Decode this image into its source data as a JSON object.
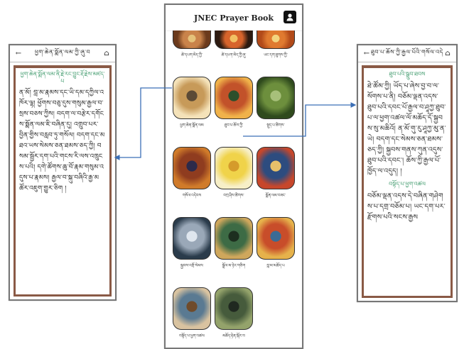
{
  "center": {
    "title": "JNEC Prayer Book",
    "tiles": [
      {
        "caption": "ཚེ་དཔག་མེད་ཀྱི་",
        "colors": [
          "#c9834a",
          "#6b3a1c",
          "#e5c27a"
        ]
      },
      {
        "caption": "ཚེ་དཔག་མེད་ཀྱི་ཞུ་",
        "colors": [
          "#d7642b",
          "#2c1a10",
          "#f2c063"
        ]
      },
      {
        "caption": "ཡང་དག་ཐུགས་ཀྱི་",
        "colors": [
          "#e07a2f",
          "#b24a19",
          "#f3d47e"
        ]
      },
      {
        "caption": "ཕྱག་ཆེན་སྨོན་ལམ",
        "colors": [
          "#c79a59",
          "#f4e2b9",
          "#5b4a36"
        ]
      },
      {
        "caption": "ཐུབ་པ་ཆོས་ཀྱི་",
        "colors": [
          "#c2522a",
          "#f0b24a",
          "#2c4f2b"
        ]
      },
      {
        "caption": "སྡུད་པ་ཚིགས་",
        "colors": [
          "#6d8f3d",
          "#2f4a1d",
          "#a7c07a"
        ]
      },
      {
        "caption": "གསོལ་འདེབས",
        "colors": [
          "#8f3c1f",
          "#d07b2a",
          "#2d2a4a"
        ]
      },
      {
        "caption": "བཀྲ་ཤིས་ཚིགས་",
        "colors": [
          "#f0d34a",
          "#f7efc7",
          "#d59b2b"
        ]
      },
      {
        "caption": "སྨོན་ལམ་བཟང་",
        "colors": [
          "#2d4c7f",
          "#c7472b",
          "#e7c06a"
        ]
      },
      {
        "caption": "སྐྱབས་འགྲོ་སེམས",
        "colors": [
          "#9aa8b8",
          "#2a3b4b",
          "#dfe6ee"
        ]
      },
      {
        "caption": "སྒྲོལ་མ་ཉེར་གཅིག",
        "colors": [
          "#3d6b45",
          "#cfa75c",
          "#1d2f1f"
        ]
      },
      {
        "caption": "བླ་མ་མཆོད་པ",
        "colors": [
          "#c84d2a",
          "#e6b24b",
          "#3a6b94"
        ]
      },
      {
        "caption": "བསྟོད་པ་ཕྱག་འཚལ",
        "colors": [
          "#5a7a92",
          "#d9c3a0",
          "#6f4b2b"
        ]
      },
      {
        "caption": "མཆོད་རྟེན་སྐོར་བ",
        "colors": [
          "#465b3c",
          "#94a36b",
          "#202920"
        ]
      }
    ]
  },
  "left_reader": {
    "title": "ཕྱག་ཆེན་སྨོན་ལམ་ཀྱི་ཞུ་བ",
    "heading": "ཕྱག་ཆེན་སྨོན་ལམ་ནི་རྗེ་རང་བྱུང་རྡོ་རྗེས་མཛད་པ",
    "text": "ན་མོ། བླ་མ་རྣམས་དང་ཡི་དམ་དཀྱིལ་འཁོར་ལྷ། ཕྱོགས་བཅུ་དུས་གསུམ་རྒྱལ་བ་སྲས་བཅས་ཀྱིས། བདག་ལ་བརྩེར་དགོངས་སྨོན་ལམ་ཇི་བཞིན་དུ། འགྲུབ་པར་བྱིན་གྱིས་བརླབ་ཏུ་གསོལ། བདག་དང་མཐའ་ཡས་སེམས་ཅན་ཐམས་ཅད་ཀྱི། བསམ་སྦྱོར་དག་པའི་གངས་རི་ལས་འཁྲུངས་པའི། དགེ་ཚོགས་ཆུ་བོ་རྣམ་གསུམ་འདུས་པ་རྣམས། རྒྱལ་བ་སྐུ་བཞིའི་རྒྱ་མཚོར་འཇུག་གྱུར་ཅིག །"
  },
  "right_reader": {
    "title": "ཐུབ་པ་ཆོས་ཀྱི་རྒྱལ་པོའི་གསོལ་འདེབས",
    "heading": "ཐུབ་པའི་སྒྲུབ་ཐབས",
    "text": "ཐེ་ཚོམ་ཀྱི། ཡོད་པ་ཞེས་བྱ་བ་ལ་སོགས་པ་ནི། བཅོམ་ལྡན་འདས་ཐུབ་པའི་དབང་པོ་རྒྱལ་བ་ཤཱཀྱ་ཐུབ་པ་ལ་ཕྱག་འཚལ་ལོ་མཆོད་དོ་སྐྱབས་སུ་མཆིའོ། ན་མོ་གུ་རུ་ཤཱཀྱ་མུ་ན་ཡེ། བདག་དང་སེམས་ཅན་ཐམས་ཅད་ཀྱི། སྐྱབས་གནས་ཀུན་འདུས་ཐུབ་པའི་དབང་། ཆོས་ཀྱི་རྒྱལ་པོ་ཁྱོད་ལ་འདུད། །",
    "heading2": "བསྟོད་པ་ཕྱག་འཚལ",
    "text2": "བཅོམ་ལྡན་འདས་དེ་བཞིན་གཤེགས་པ་དགྲ་བཅོམ་པ། ཡང་དག་པར་རྫོགས་པའི་སངས་རྒྱས"
  }
}
